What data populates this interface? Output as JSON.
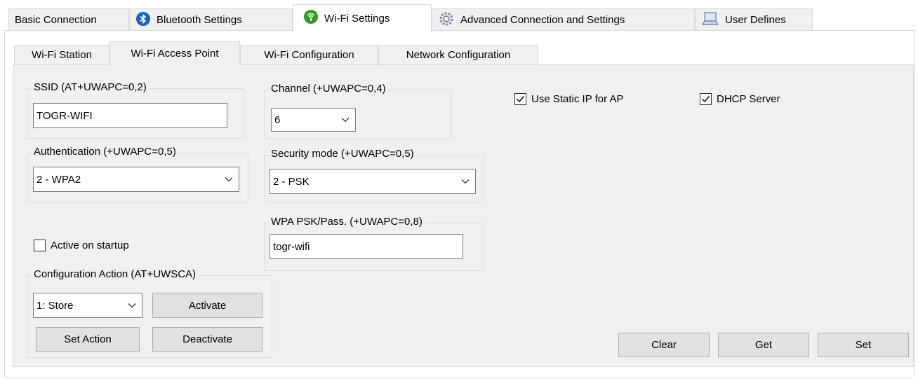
{
  "top_tabs": [
    {
      "label": "Basic Connection",
      "icon": ""
    },
    {
      "label": "Bluetooth Settings",
      "icon": "bluetooth-icon"
    },
    {
      "label": "Wi-Fi Settings",
      "icon": "wifi-icon"
    },
    {
      "label": "Advanced Connection and Settings",
      "icon": "gear-icon"
    },
    {
      "label": "User Defines",
      "icon": "laptop-icon"
    }
  ],
  "sub_tabs": [
    {
      "label": "Wi-Fi Station"
    },
    {
      "label": "Wi-Fi Access Point"
    },
    {
      "label": "Wi-Fi Configuration"
    },
    {
      "label": "Network Configuration"
    }
  ],
  "ssid": {
    "label": "SSID (AT+UWAPC=0,2)",
    "value": "TOGR-WIFI"
  },
  "channel": {
    "label": "Channel (+UWAPC=0,4)",
    "value": "6"
  },
  "authentication": {
    "label": "Authentication (+UWAPC=0,5)",
    "value": "2 - WPA2"
  },
  "security_mode": {
    "label": "Security mode (+UWAPC=0,5)",
    "value": "2 - PSK"
  },
  "wpa_psk": {
    "label": "WPA PSK/Pass. (+UWAPC=0,8)",
    "value": "togr-wifi"
  },
  "active_on_startup": {
    "label": "Active on startup",
    "checked": false
  },
  "static_ip": {
    "label": "Use Static IP for AP",
    "checked": true
  },
  "dhcp_server": {
    "label": "DHCP Server",
    "checked": true
  },
  "config_action": {
    "label": "Configuration Action (AT+UWSCA)",
    "value": "1: Store",
    "activate": "Activate",
    "set_action": "Set Action",
    "deactivate": "Deactivate"
  },
  "buttons": {
    "clear": "Clear",
    "get": "Get",
    "set": "Set"
  },
  "colors": {
    "panel": "#f0f0f0",
    "bluetooth": "#1565c0",
    "wifi": "#2e9e1e"
  }
}
